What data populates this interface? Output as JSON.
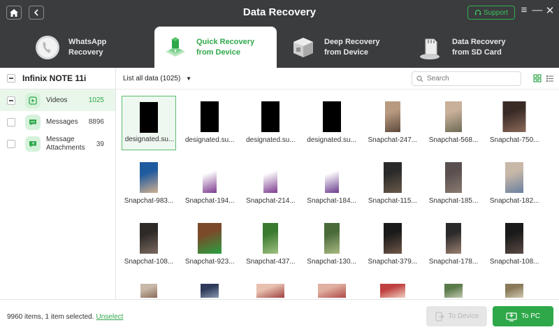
{
  "app": {
    "title": "Data Recovery",
    "support_label": "Support"
  },
  "tabs": [
    {
      "label": "WhatsApp\nRecovery",
      "active": false
    },
    {
      "label": "Quick Recovery\nfrom Device",
      "active": true
    },
    {
      "label": "Deep Recovery\nfrom Device",
      "active": false
    },
    {
      "label": "Data Recovery\nfrom SD Card",
      "active": false
    }
  ],
  "device": {
    "name": "Infinix NOTE 11i"
  },
  "categories": [
    {
      "label": "Videos",
      "count": "1025",
      "icon": "play-icon"
    },
    {
      "label": "Messages",
      "count": "8896",
      "icon": "message-icon"
    },
    {
      "label": "Message Attachments",
      "count": "39",
      "icon": "attachment-icon"
    }
  ],
  "toolbar": {
    "filter_label": "List all data (1025)",
    "search_placeholder": "Search"
  },
  "files": [
    "designated.su...",
    "designated.su...",
    "designated.su...",
    "designated.su...",
    "Snapchat-247...",
    "Snapchat-568...",
    "Snapchat-750...",
    "Snapchat-983...",
    "Snapchat-194...",
    "Snapchat-214...",
    "Snapchat-184...",
    "Snapchat-115...",
    "Snapchat-185...",
    "Snapchat-182...",
    "Snapchat-108...",
    "Snapchat-923...",
    "Snapchat-437...",
    "Snapchat-130...",
    "Snapchat-379...",
    "Snapchat-178...",
    "Snapchat-108...",
    "",
    "",
    "",
    "",
    "",
    "",
    ""
  ],
  "footer": {
    "status": "9960 items, 1 item selected.",
    "unselect_label": "Unselect",
    "to_device_label": "To Device",
    "to_pc_label": "To PC"
  },
  "colors": {
    "accent": "#2fa84a",
    "header_bg": "#3a3c3e"
  }
}
